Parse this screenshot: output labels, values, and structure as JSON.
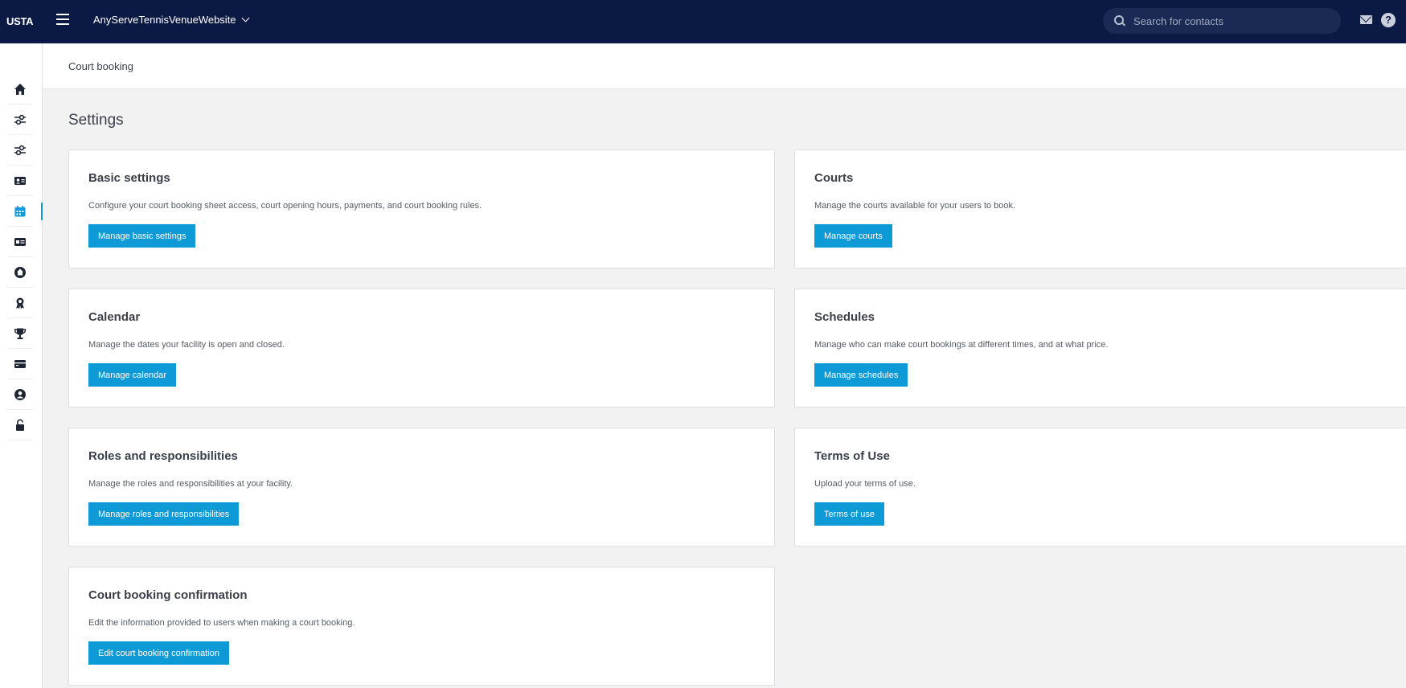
{
  "topbar": {
    "logo": "USTA",
    "site_name": "AnyServeTennisVenueWebsite",
    "search_placeholder": "Search for contacts",
    "help_glyph": "?"
  },
  "sidebar": {
    "items": [
      {
        "icon": "home-icon",
        "active": false
      },
      {
        "icon": "sliders-icon",
        "active": false
      },
      {
        "icon": "sliders-icon",
        "active": false
      },
      {
        "icon": "contact-card-icon",
        "active": false
      },
      {
        "icon": "calendar-icon",
        "active": true
      },
      {
        "icon": "id-card-icon",
        "active": false
      },
      {
        "icon": "venue-icon",
        "active": false
      },
      {
        "icon": "award-icon",
        "active": false
      },
      {
        "icon": "trophy-icon",
        "active": false
      },
      {
        "icon": "ticket-icon",
        "active": false
      },
      {
        "icon": "user-icon",
        "active": false
      },
      {
        "icon": "unlock-icon",
        "active": false
      }
    ]
  },
  "header": {
    "breadcrumb": "Court booking"
  },
  "main": {
    "title": "Settings",
    "cards": [
      {
        "title": "Basic settings",
        "description": "Configure your court booking sheet access, court opening hours, payments, and court booking rules.",
        "button": "Manage basic settings"
      },
      {
        "title": "Courts",
        "description": "Manage the courts available for your users to book.",
        "button": "Manage courts"
      },
      {
        "title": "Calendar",
        "description": "Manage the dates your facility is open and closed.",
        "button": "Manage calendar"
      },
      {
        "title": "Schedules",
        "description": "Manage who can make court bookings at different times, and at what price.",
        "button": "Manage schedules"
      },
      {
        "title": "Roles and responsibilities",
        "description": "Manage the roles and responsibilities at your facility.",
        "button": "Manage roles and responsibilities"
      },
      {
        "title": "Terms of Use",
        "description": "Upload your terms of use.",
        "button": "Terms of use"
      },
      {
        "title": "Court booking confirmation",
        "description": "Edit the information provided to users when making a court booking.",
        "button": "Edit court booking confirmation"
      }
    ]
  },
  "colors": {
    "topbar": "#0b1a44",
    "accent": "#0e9ad6",
    "background": "#f2f2f2"
  }
}
